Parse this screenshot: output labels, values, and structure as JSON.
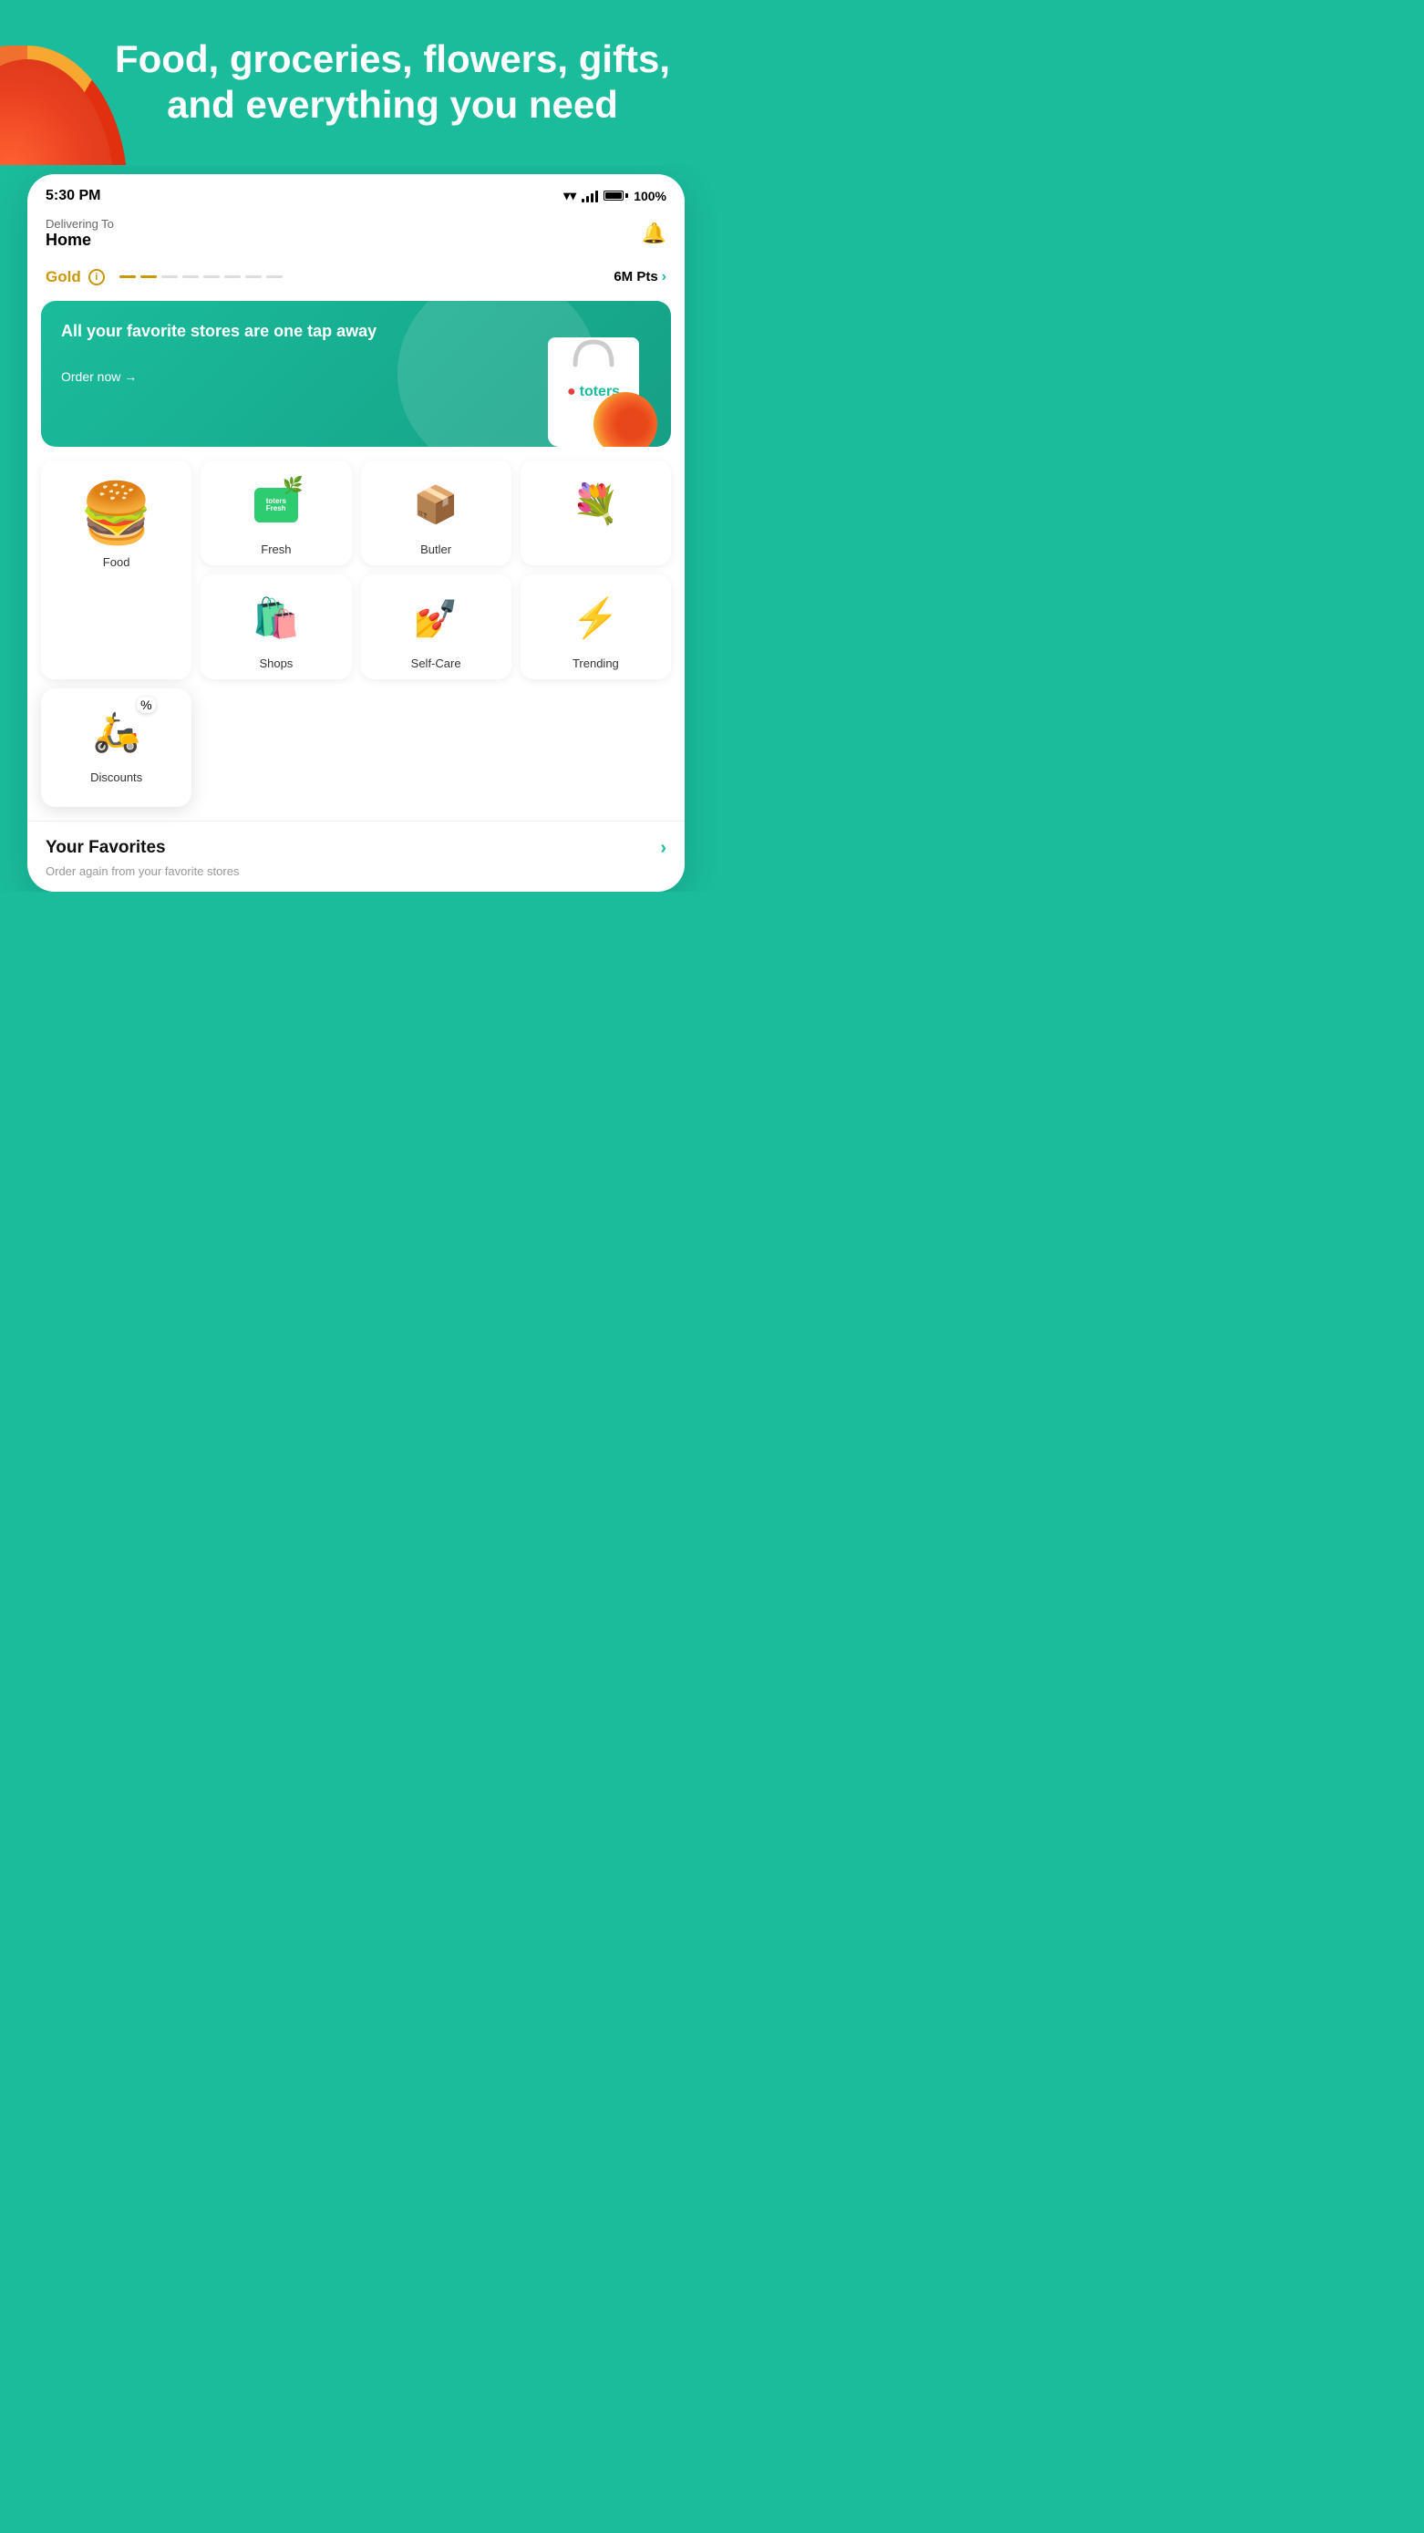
{
  "hero": {
    "title": "Food, groceries, flowers, gifts, and everything you need"
  },
  "statusBar": {
    "time": "5:30 PM",
    "battery": "100%"
  },
  "header": {
    "deliveringTo": "Delivering To",
    "location": "Home"
  },
  "tierSection": {
    "tierLabel": "Gold",
    "infoLabel": "i",
    "points": "6M Pts"
  },
  "banner": {
    "headline": "All your favorite stores are one tap away",
    "cta": "Order now →",
    "brandName": "toters"
  },
  "categories": [
    {
      "id": "food",
      "label": "Food",
      "emoji": "🍔",
      "large": true
    },
    {
      "id": "fresh",
      "label": "Fresh",
      "emoji": "🥦",
      "large": false
    },
    {
      "id": "butler",
      "label": "Butler",
      "emoji": "📦",
      "large": false
    },
    {
      "id": "flowers",
      "label": "",
      "emoji": "💐",
      "large": false
    },
    {
      "id": "shops",
      "label": "Shops",
      "emoji": "🛍️",
      "large": false
    },
    {
      "id": "selfcare",
      "label": "Self-Care",
      "emoji": "💄",
      "large": false
    },
    {
      "id": "trending",
      "label": "Trending",
      "emoji": "⚡",
      "large": false
    },
    {
      "id": "discounts",
      "label": "Discounts",
      "emoji": "🛵",
      "large": false,
      "floating": true
    }
  ],
  "favorites": {
    "title": "Your Favorites",
    "subtitle": "Order again from your favorite stores"
  }
}
